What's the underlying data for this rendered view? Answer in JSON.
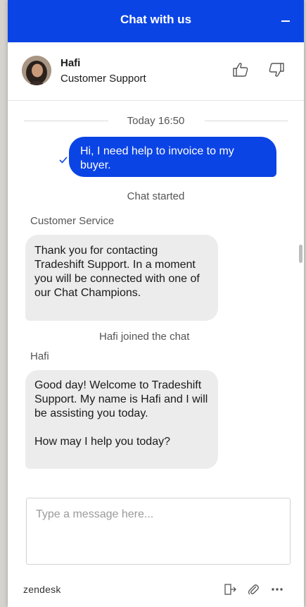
{
  "header": {
    "title": "Chat with us",
    "minimize_icon": "minus-icon"
  },
  "agent": {
    "name": "Hafi",
    "role": "Customer Support",
    "rate_up_icon": "thumbs-up-icon",
    "rate_down_icon": "thumbs-down-icon"
  },
  "conversation": {
    "date_divider": "Today 16:50",
    "outgoing": {
      "text": "Hi, I need help to invoice to my buyer.",
      "status_icon": "check-icon"
    },
    "system_chat_started": "Chat started",
    "message1": {
      "sender": "Customer Service",
      "text": "Thank you for contacting Tradeshift Support. In a moment you will be connected with one of our Chat Champions."
    },
    "system_joined": "Hafi joined the chat",
    "message2": {
      "sender": "Hafi",
      "text": "Good day! Welcome to Tradeshift Support. My name is Hafi and I will be assisting you today.\n\nHow may I help you today?"
    }
  },
  "composer": {
    "placeholder": "Type a message here...",
    "value": ""
  },
  "footer": {
    "brand": "zendesk",
    "icons": [
      "end-chat-icon",
      "attachment-icon",
      "more-options-icon"
    ]
  },
  "colors": {
    "accent": "#0b44e5",
    "bubble_incoming": "#ececec",
    "text_muted": "#555555"
  }
}
